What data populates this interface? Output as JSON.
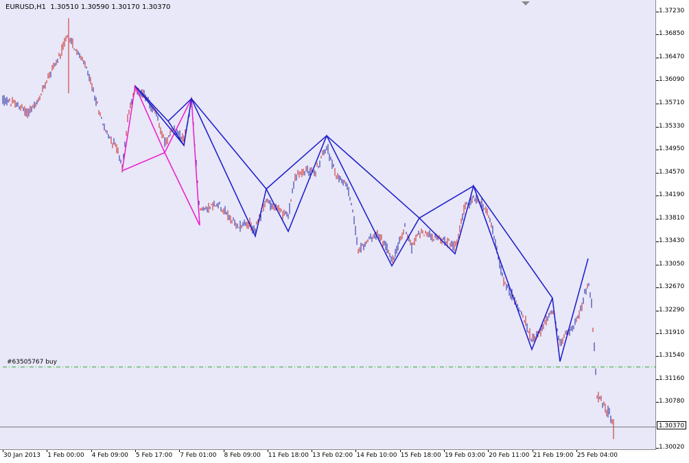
{
  "window": {
    "symbol_info": "EURUSD,H1  1.30510 1.30590 1.30170 1.30370",
    "current_price": "1.30370"
  },
  "order_line": {
    "label": "#63505767 buy",
    "price": 1.3136,
    "color": "#22aa22"
  },
  "colors": {
    "background": "#e8e8f8",
    "bull_candle": "#2020a0",
    "bear_candle": "#cc2020",
    "pattern_blue": "#2020cc",
    "pattern_magenta": "#ee22cc"
  },
  "y_axis": {
    "ticks": [
      "1.37230",
      "1.36850",
      "1.36470",
      "1.36090",
      "1.35710",
      "1.35330",
      "1.34950",
      "1.34570",
      "1.34190",
      "1.33810",
      "1.33430",
      "1.33050",
      "1.32670",
      "1.32290",
      "1.31910",
      "1.31540",
      "1.31160",
      "1.30780",
      "1.30020"
    ]
  },
  "x_axis": {
    "labels": [
      "30 Jan 2013",
      "1 Feb 00:00",
      "4 Feb 09:00",
      "5 Feb 17:00",
      "7 Feb 01:00",
      "8 Feb 09:00",
      "11 Feb 18:00",
      "13 Feb 02:00",
      "14 Feb 10:00",
      "15 Feb 18:00",
      "19 Feb 03:00",
      "20 Feb 11:00",
      "21 Feb 19:00",
      "25 Feb 04:00"
    ]
  },
  "chart_data": {
    "type": "candlestick",
    "symbol": "EURUSD",
    "timeframe": "H1",
    "price_path": [
      [
        0,
        1.3578
      ],
      [
        20,
        1.3572
      ],
      [
        40,
        1.3556
      ],
      [
        55,
        1.3572
      ],
      [
        70,
        1.3617
      ],
      [
        85,
        1.3645
      ],
      [
        100,
        1.3688
      ],
      [
        110,
        1.366
      ],
      [
        125,
        1.3632
      ],
      [
        140,
        1.3575
      ],
      [
        155,
        1.3522
      ],
      [
        170,
        1.35
      ],
      [
        178,
        1.3462
      ],
      [
        187,
        1.3555
      ],
      [
        197,
        1.3595
      ],
      [
        210,
        1.3585
      ],
      [
        228,
        1.3555
      ],
      [
        240,
        1.3505
      ],
      [
        255,
        1.353
      ],
      [
        268,
        1.351
      ],
      [
        279,
        1.3572
      ],
      [
        285,
        1.349
      ],
      [
        291,
        1.3395
      ],
      [
        305,
        1.34
      ],
      [
        320,
        1.3405
      ],
      [
        330,
        1.339
      ],
      [
        345,
        1.3367
      ],
      [
        358,
        1.3375
      ],
      [
        372,
        1.3363
      ],
      [
        388,
        1.341
      ],
      [
        400,
        1.34
      ],
      [
        420,
        1.3385
      ],
      [
        430,
        1.345
      ],
      [
        445,
        1.346
      ],
      [
        460,
        1.3458
      ],
      [
        476,
        1.3502
      ],
      [
        490,
        1.345
      ],
      [
        505,
        1.344
      ],
      [
        515,
        1.339
      ],
      [
        522,
        1.3325
      ],
      [
        535,
        1.3345
      ],
      [
        550,
        1.3355
      ],
      [
        565,
        1.333
      ],
      [
        571,
        1.331
      ],
      [
        590,
        1.3365
      ],
      [
        600,
        1.3335
      ],
      [
        611,
        1.336
      ],
      [
        625,
        1.3355
      ],
      [
        645,
        1.3345
      ],
      [
        663,
        1.3335
      ],
      [
        676,
        1.3395
      ],
      [
        690,
        1.3415
      ],
      [
        705,
        1.34
      ],
      [
        715,
        1.338
      ],
      [
        725,
        1.332
      ],
      [
        735,
        1.3275
      ],
      [
        748,
        1.325
      ],
      [
        760,
        1.3225
      ],
      [
        775,
        1.3183
      ],
      [
        790,
        1.3198
      ],
      [
        805,
        1.3234
      ],
      [
        816,
        1.3175
      ],
      [
        830,
        1.3195
      ],
      [
        845,
        1.3225
      ],
      [
        857,
        1.3275
      ],
      [
        862,
        1.324
      ],
      [
        866,
        1.317
      ],
      [
        870,
        1.309
      ],
      [
        878,
        1.3075
      ],
      [
        888,
        1.306
      ],
      [
        894,
        1.3037
      ]
    ],
    "patterns": [
      {
        "color": "#ee22cc",
        "points": [
          [
            178,
            1.346
          ],
          [
            197,
            1.36
          ],
          [
            240,
            1.349
          ],
          [
            279,
            1.3579
          ],
          [
            291,
            1.337
          ],
          [
            240,
            1.349
          ],
          [
            178,
            1.346
          ]
        ]
      },
      {
        "color": "#2020cc",
        "points": [
          [
            197,
            1.36
          ],
          [
            245,
            1.3542
          ],
          [
            268,
            1.3502
          ],
          [
            279,
            1.3579
          ],
          [
            372,
            1.3352
          ],
          [
            388,
            1.343
          ],
          [
            420,
            1.336
          ],
          [
            476,
            1.3518
          ],
          [
            571,
            1.3303
          ],
          [
            611,
            1.3382
          ],
          [
            663,
            1.3323
          ],
          [
            690,
            1.3435
          ],
          [
            775,
            1.3165
          ],
          [
            805,
            1.325
          ],
          [
            816,
            1.3145
          ],
          [
            857,
            1.3315
          ]
        ]
      },
      {
        "color": "#2020cc",
        "points": [
          [
            197,
            1.36
          ],
          [
            268,
            1.3502
          ]
        ]
      },
      {
        "color": "#2020cc",
        "points": [
          [
            245,
            1.3542
          ],
          [
            279,
            1.3579
          ]
        ]
      },
      {
        "color": "#2020cc",
        "points": [
          [
            279,
            1.3579
          ],
          [
            388,
            1.343
          ]
        ]
      },
      {
        "color": "#2020cc",
        "points": [
          [
            388,
            1.343
          ],
          [
            476,
            1.3518
          ]
        ]
      },
      {
        "color": "#2020cc",
        "points": [
          [
            476,
            1.3518
          ],
          [
            611,
            1.3382
          ]
        ]
      },
      {
        "color": "#2020cc",
        "points": [
          [
            611,
            1.3382
          ],
          [
            690,
            1.3435
          ]
        ]
      },
      {
        "color": "#2020cc",
        "points": [
          [
            690,
            1.3435
          ],
          [
            805,
            1.325
          ]
        ]
      }
    ],
    "ylim": [
      1.2999,
      1.3742
    ]
  }
}
